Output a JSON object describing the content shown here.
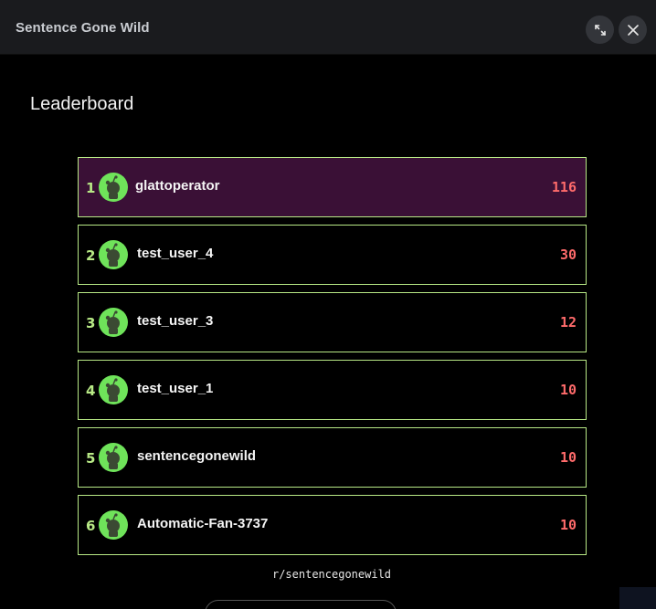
{
  "window": {
    "title": "Sentence Gone Wild",
    "expand_icon": "expand-arrows-icon",
    "close_icon": "close-x-icon"
  },
  "leaderboard": {
    "heading": "Leaderboard",
    "entries": [
      {
        "rank": "1",
        "username": "glattoperator",
        "score": "116",
        "highlighted": true
      },
      {
        "rank": "2",
        "username": "test_user_4",
        "score": "30",
        "highlighted": false
      },
      {
        "rank": "3",
        "username": "test_user_3",
        "score": "12",
        "highlighted": false
      },
      {
        "rank": "4",
        "username": "test_user_1",
        "score": "10",
        "highlighted": false
      },
      {
        "rank": "5",
        "username": "sentencegonewild",
        "score": "10",
        "highlighted": false
      },
      {
        "rank": "6",
        "username": "Automatic-Fan-3737",
        "score": "10",
        "highlighted": false
      }
    ]
  },
  "footer": {
    "subreddit": "r/sentencegonewild"
  },
  "colors": {
    "accent_green": "#b8e986",
    "score_red": "#ff6b6b",
    "highlight_row": "#3a1036",
    "avatar_green": "#6fe35a",
    "titlebar": "#1a1b1e"
  }
}
